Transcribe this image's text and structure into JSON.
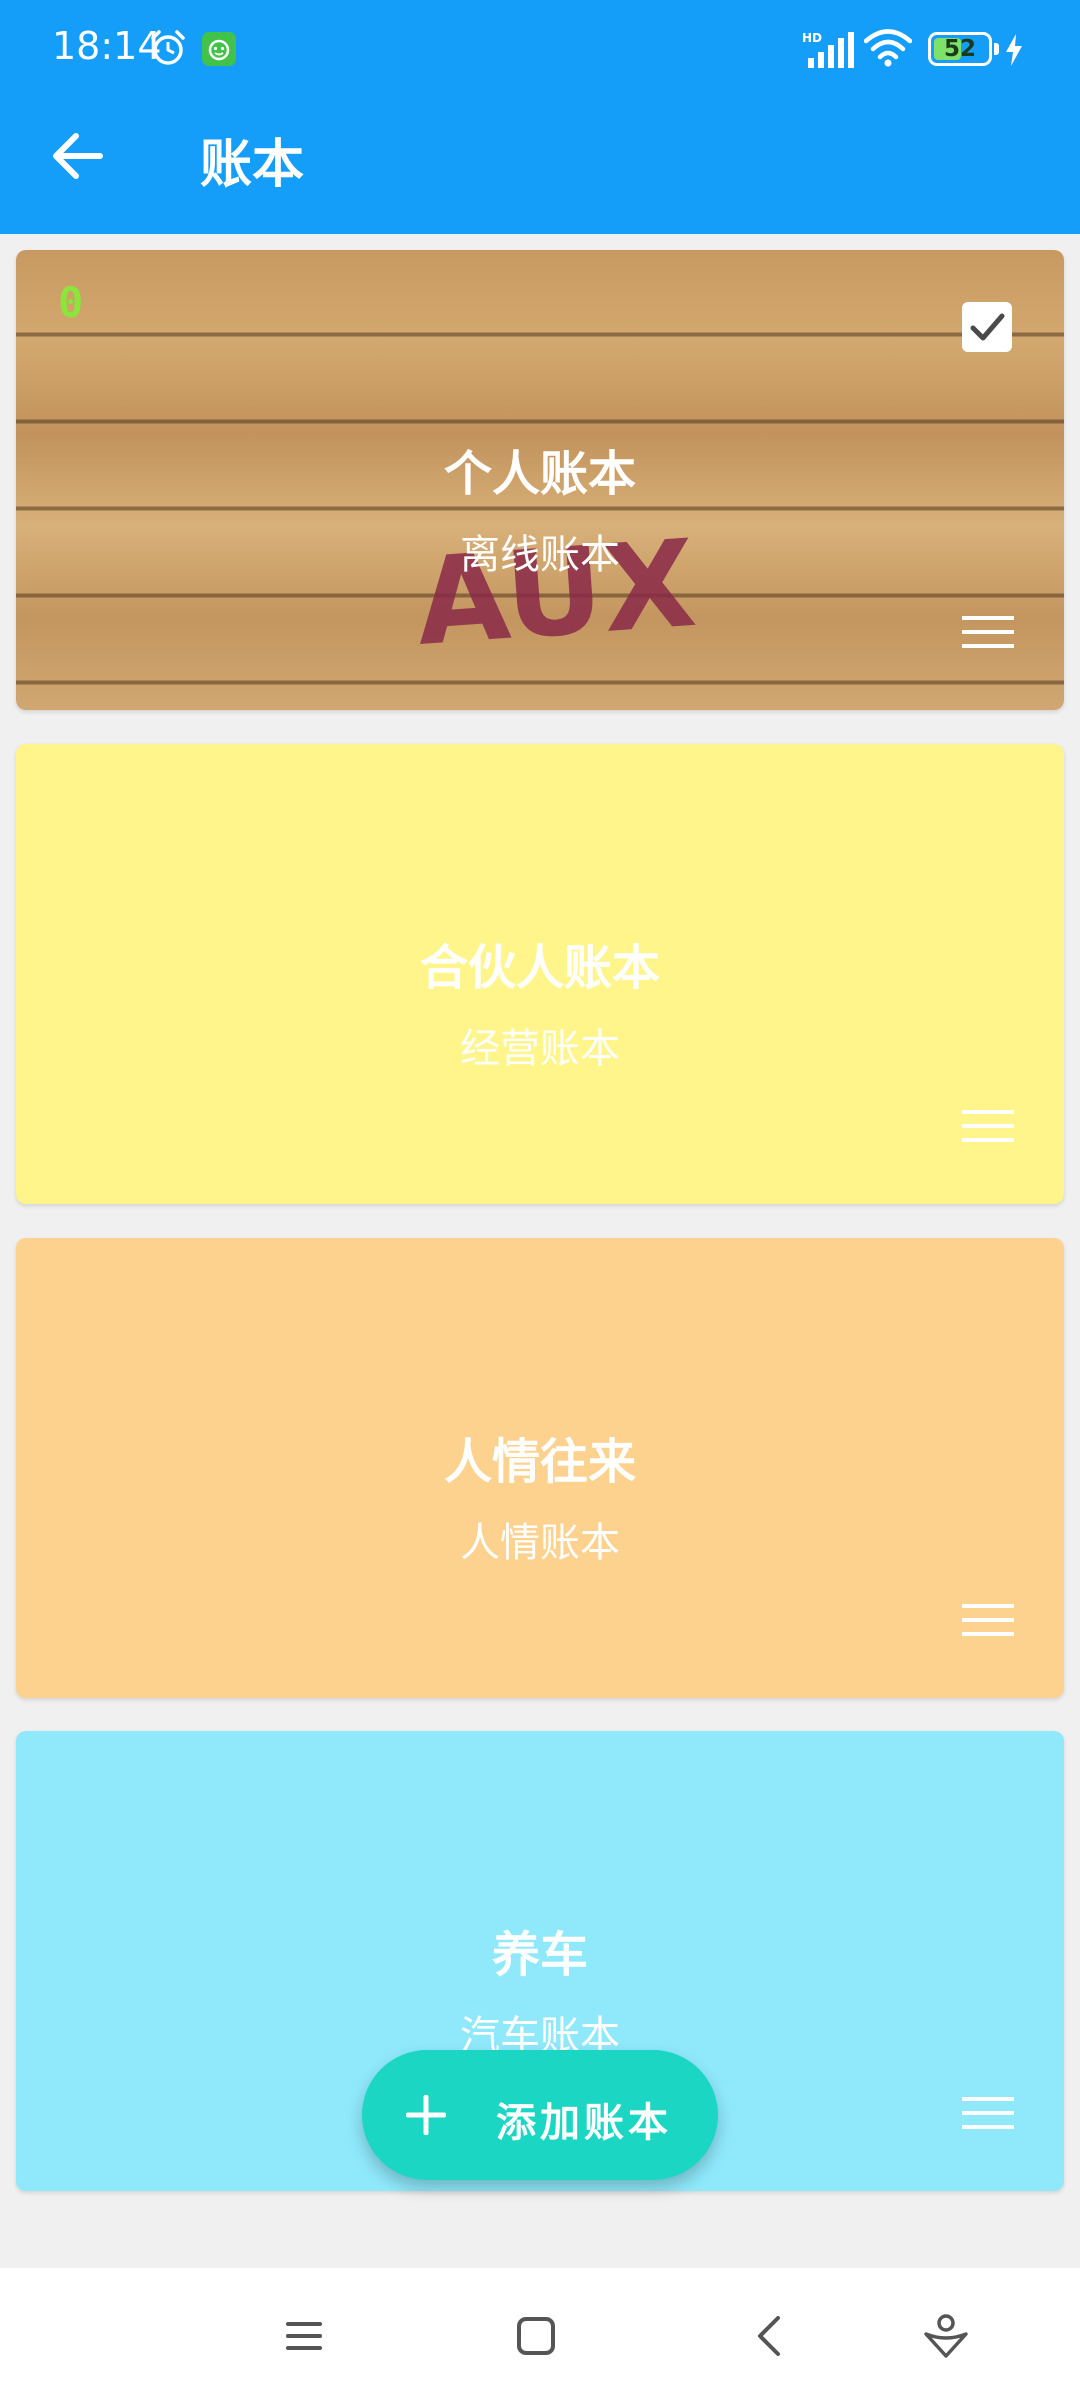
{
  "status_bar": {
    "time": "18:14",
    "network": "HD",
    "battery": "52",
    "battery_level": 0.52
  },
  "header": {
    "title": "账本"
  },
  "books": [
    {
      "title": "个人账本",
      "subtitle": "离线账本",
      "background": "wood-image",
      "badge": "0",
      "graffiti_text": "AUX",
      "selected": true
    },
    {
      "title": "合伙人账本",
      "subtitle": "经营账本",
      "background": "#fff58a"
    },
    {
      "title": "人情往来",
      "subtitle": "人情账本",
      "background": "#fdd18e"
    },
    {
      "title": "养车",
      "subtitle": "汽车账本",
      "background": "#8fe9fb"
    }
  ],
  "fab": {
    "label": "添加账本",
    "color": "#1ad6c3"
  },
  "colors": {
    "app_bar": "#159ef9",
    "background": "#f0f0f0"
  },
  "nav_bar": {
    "icons": [
      "menu-icon",
      "home-icon",
      "back-icon",
      "assistant-icon"
    ]
  }
}
